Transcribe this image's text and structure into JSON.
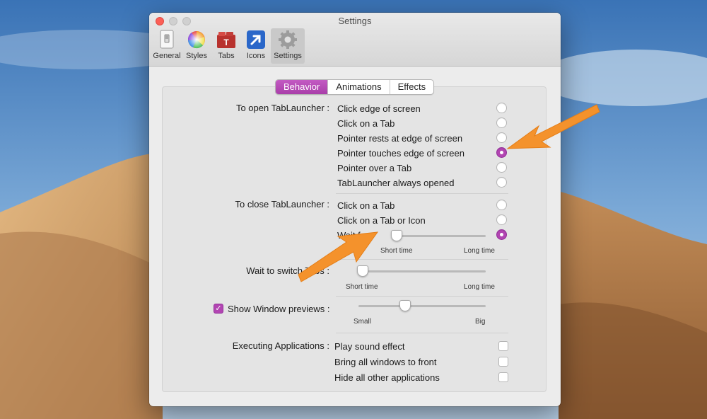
{
  "window": {
    "title": "Settings"
  },
  "toolbar": [
    {
      "label": "General",
      "icon": "switch-icon"
    },
    {
      "label": "Styles",
      "icon": "color-wheel-icon"
    },
    {
      "label": "Tabs",
      "icon": "tabs-icon"
    },
    {
      "label": "Icons",
      "icon": "arrow-icon"
    },
    {
      "label": "Settings",
      "icon": "gear-icon"
    }
  ],
  "tabs": [
    "Behavior",
    "Animations",
    "Effects"
  ],
  "open": {
    "label": "To open TabLauncher :",
    "options": [
      "Click edge of screen",
      "Click on a Tab",
      "Pointer rests at edge of screen",
      "Pointer touches edge of screen",
      "Pointer over a Tab",
      "TabLauncher always opened"
    ],
    "selected_index": 3
  },
  "close": {
    "label": "To close TabLauncher :",
    "options": [
      "Click on a Tab",
      "Click on a Tab or Icon",
      "Wait for"
    ],
    "selected_index": 2,
    "slider_min_label": "Short time",
    "slider_max_label": "Long time",
    "slider_value": 0.05
  },
  "switch": {
    "label": "Wait to switch Tabs :",
    "slider_min_label": "Short time",
    "slider_max_label": "Long time",
    "slider_value": 0.0
  },
  "previews": {
    "label": "Show Window previews :",
    "checked": true,
    "slider_min_label": "Small",
    "slider_max_label": "Big",
    "slider_value": 0.4
  },
  "executing": {
    "label": "Executing Applications :",
    "options": [
      "Play sound effect",
      "Bring all windows to front",
      "Hide all other applications"
    ]
  },
  "colors": {
    "accent": "#b245b2",
    "annotation_arrow": "#f4922c"
  }
}
